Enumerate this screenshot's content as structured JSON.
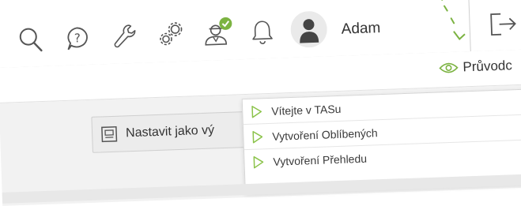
{
  "header": {
    "icons": [
      "search-icon",
      "help-icon",
      "wrench-icon",
      "settings-icon",
      "user-approved-icon",
      "bell-icon",
      "avatar"
    ],
    "user_name": "Adam",
    "logout_icon": "logout-icon",
    "status_badge_color": "#7cb342"
  },
  "subbar": {
    "guide_icon": "eye-icon",
    "guide_label": "Průvodc"
  },
  "main": {
    "default_button_icon": "layout-icon",
    "default_button_label": "Nastavit jako vý"
  },
  "tour_menu": {
    "items": [
      {
        "icon": "play-icon",
        "label": "Vítejte v TASu"
      },
      {
        "icon": "play-icon",
        "label": "Vytvoření Oblíbených"
      },
      {
        "icon": "play-icon",
        "label": "Vytvoření Přehledu"
      }
    ],
    "accent_color": "#8bc34a"
  },
  "colors": {
    "accent": "#7cb342",
    "text": "#333333",
    "icon": "#555555"
  }
}
